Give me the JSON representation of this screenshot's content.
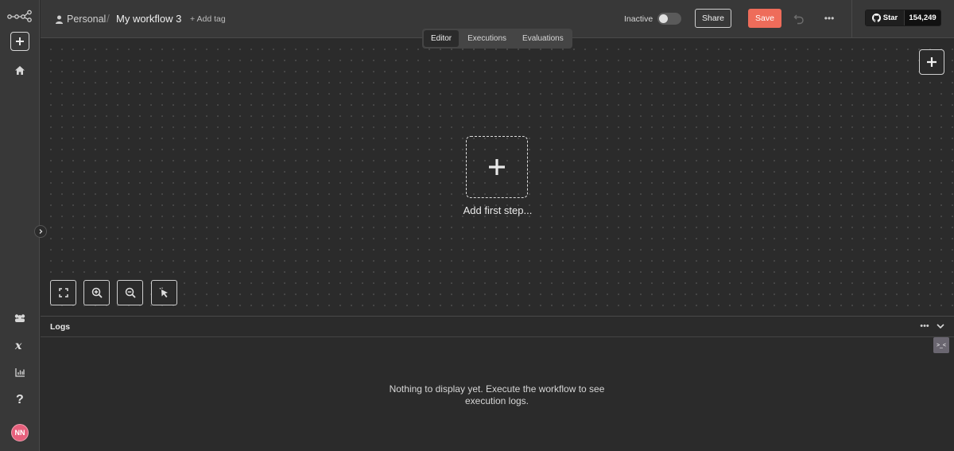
{
  "breadcrumb": {
    "owner": "Personal",
    "workflow_name": "My workflow 3",
    "add_tag": "+ Add tag"
  },
  "header": {
    "status_label": "Inactive",
    "share_label": "Share",
    "save_label": "Save",
    "github": {
      "star_label": "Star",
      "star_count": "154,249"
    }
  },
  "tabs": [
    {
      "label": "Editor",
      "active": true
    },
    {
      "label": "Executions",
      "active": false
    },
    {
      "label": "Evaluations",
      "active": false
    }
  ],
  "canvas": {
    "add_first_step": "Add first step..."
  },
  "logs": {
    "title": "Logs",
    "empty_message": "Nothing to display yet. Execute the workflow to see execution logs."
  },
  "user": {
    "initials": "NN"
  },
  "colors": {
    "accent": "#ee6c5a",
    "background": "#2b2b2b",
    "panel": "#383838"
  },
  "icons": [
    "n8n-logo",
    "plus-icon",
    "home-icon",
    "templates-icon",
    "variables-icon",
    "insights-icon",
    "help-icon",
    "undo-icon",
    "more-icon",
    "github-icon",
    "fit-view-icon",
    "zoom-in-icon",
    "zoom-out-icon",
    "tidy-up-icon",
    "chevron-down-icon",
    "chevron-right-icon"
  ]
}
